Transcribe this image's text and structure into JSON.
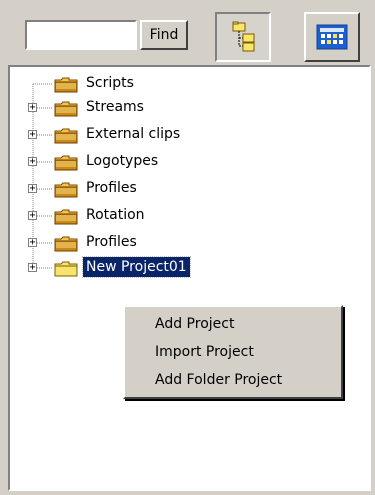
{
  "search": {
    "value": "",
    "placeholder": ""
  },
  "toolbar": {
    "find_label": "Find",
    "tree_view_icon": "tree-view-icon",
    "grid_view_icon": "grid-view-icon"
  },
  "tree": {
    "items": [
      {
        "label": "Scripts",
        "expandable": false,
        "selected": false
      },
      {
        "label": "Streams",
        "expandable": true,
        "selected": false
      },
      {
        "label": "External clips",
        "expandable": true,
        "selected": false
      },
      {
        "label": "Logotypes",
        "expandable": true,
        "selected": false
      },
      {
        "label": "Profiles",
        "expandable": true,
        "selected": false
      },
      {
        "label": "Rotation",
        "expandable": true,
        "selected": false
      },
      {
        "label": "Profiles",
        "expandable": true,
        "selected": false
      },
      {
        "label": "New Project01",
        "expandable": true,
        "selected": true
      }
    ]
  },
  "context_menu": {
    "items": [
      {
        "label": "Add Project"
      },
      {
        "label": "Import Project"
      },
      {
        "label": "Add Folder Project"
      }
    ]
  },
  "colors": {
    "window_bg": "#d4d0c8",
    "selection_bg": "#0a246a",
    "folder_yellow": "#f7d96d",
    "folder_orange": "#b86e14"
  }
}
